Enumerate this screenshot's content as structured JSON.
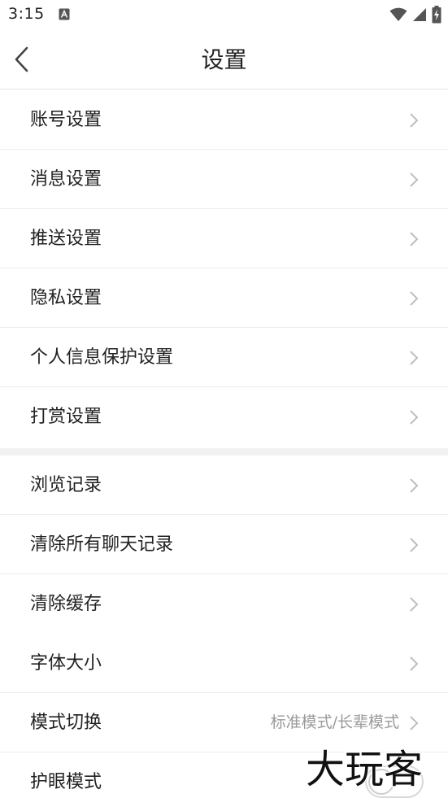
{
  "status_bar": {
    "time": "3:15",
    "notification_icon": "accessibility-a-icon",
    "icons": [
      "wifi-icon",
      "cellular-signal-icon",
      "battery-charging-icon"
    ]
  },
  "header": {
    "title": "设置",
    "back_icon": "chevron-left-icon"
  },
  "group_a": [
    {
      "id": "account",
      "label": "账号设置"
    },
    {
      "id": "message",
      "label": "消息设置"
    },
    {
      "id": "push",
      "label": "推送设置"
    },
    {
      "id": "privacy",
      "label": "隐私设置"
    },
    {
      "id": "personal-info-protection",
      "label": "个人信息保护设置"
    },
    {
      "id": "reward",
      "label": "打赏设置"
    }
  ],
  "group_b": [
    {
      "id": "browse-history",
      "label": "浏览记录"
    },
    {
      "id": "clear-chat",
      "label": "清除所有聊天记录"
    },
    {
      "id": "clear-cache",
      "label": "清除缓存"
    },
    {
      "id": "font-size",
      "label": "字体大小"
    },
    {
      "id": "mode-switch",
      "label": "模式切换",
      "value": "标准模式/长辈模式"
    },
    {
      "id": "eye-care",
      "label": "护眼模式",
      "toggle": false
    }
  ],
  "watermark": {
    "text": "大玩客"
  },
  "colors": {
    "text": "#222222",
    "secondary_text": "#9a9a9a",
    "divider": "#ececec",
    "group_gap": "#f2f2f2",
    "chevron": "#bdbdbd"
  }
}
